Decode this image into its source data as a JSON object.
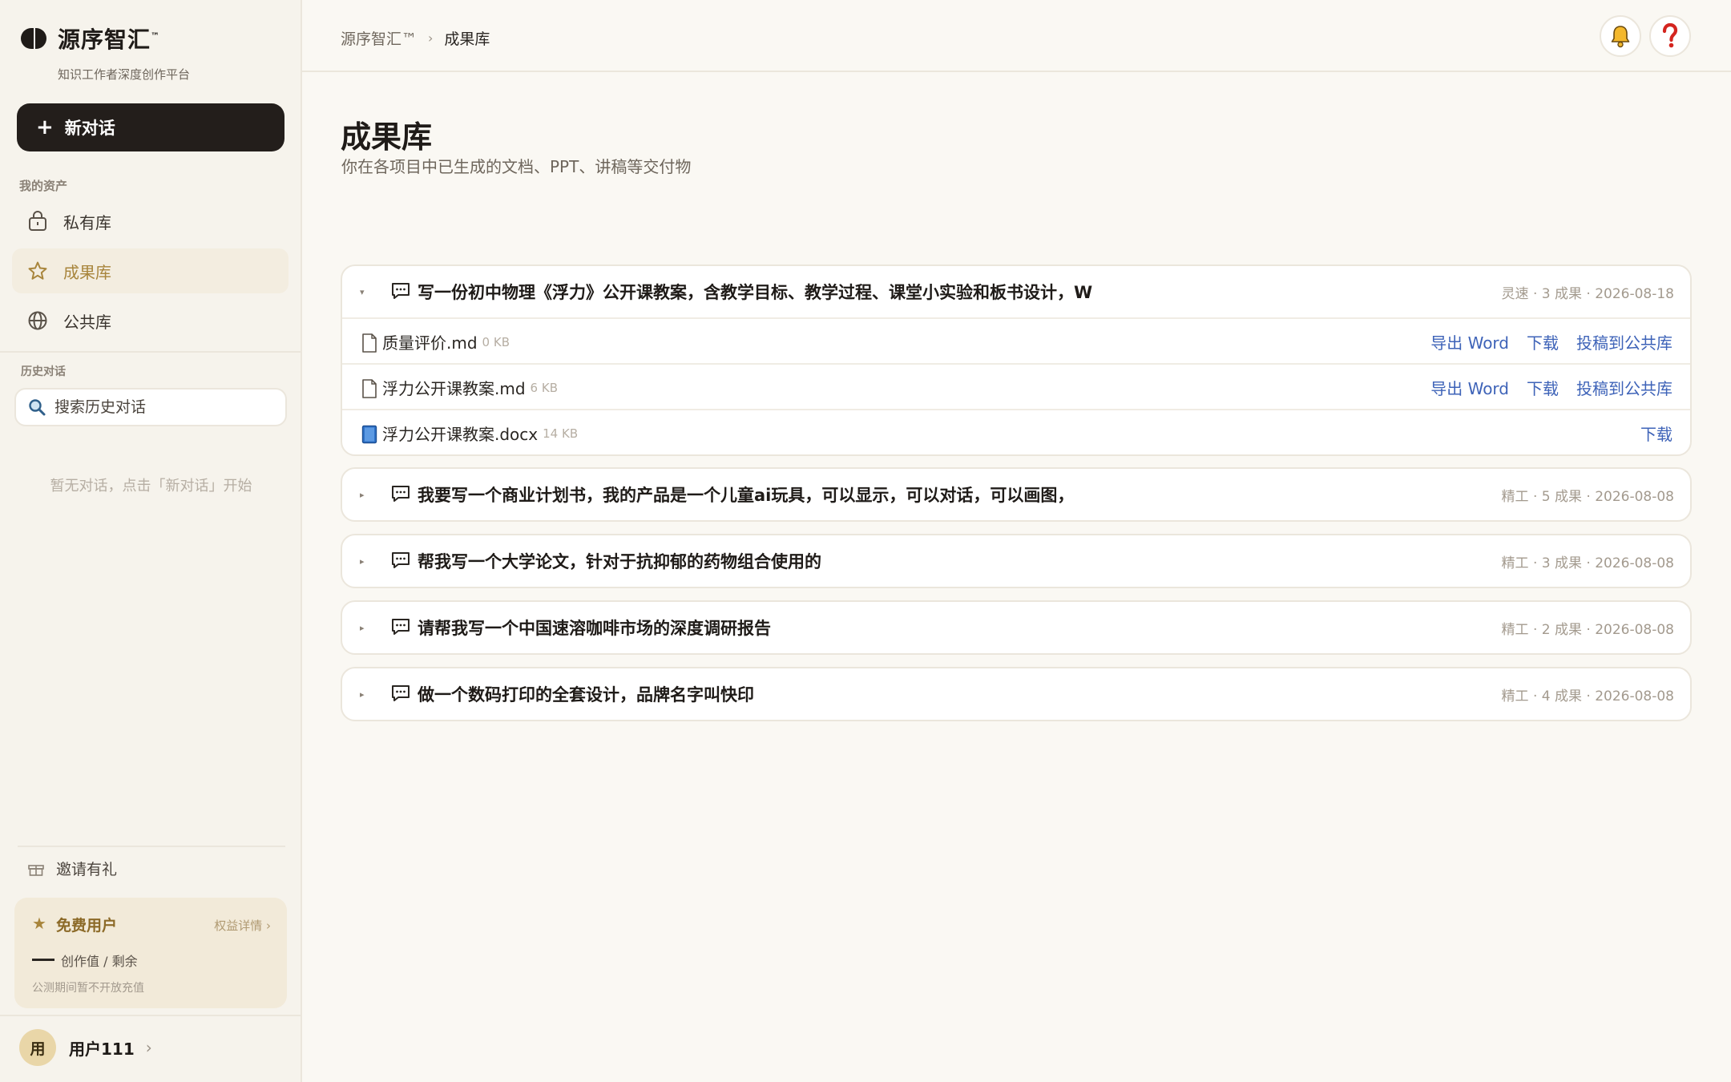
{
  "brand": {
    "name": "源序智汇",
    "tm": "™",
    "subtitle": "知识工作者深度创作平台"
  },
  "sidebar": {
    "new_chat": {
      "icon": "+",
      "label": "新对话"
    },
    "assets_title": "我的资产",
    "items": [
      {
        "label": "私有库",
        "icon": "lock-icon",
        "active": false
      },
      {
        "label": "成果库",
        "icon": "star-icon",
        "active": true
      },
      {
        "label": "公共库",
        "icon": "globe-icon",
        "active": false
      }
    ],
    "history_title": "历史对话",
    "search_placeholder": "搜索历史对话",
    "empty_hint": "暂无对话，点击「新对话」开始",
    "invite_label": "邀请有礼",
    "plan": {
      "star": "★",
      "name": "免费用户",
      "link": "权益详情 ›",
      "credit": "创作值 / 剩余",
      "note": "公测期间暂不开放充值"
    },
    "user": {
      "avatar": "用",
      "name": "用户111",
      "chevron": "›"
    }
  },
  "header": {
    "breadcrumbs": [
      "源序智汇™",
      "成果库"
    ],
    "separator": "›"
  },
  "main": {
    "title": "成果库",
    "subtitle": "你在各项目中已生成的文档、PPT、讲稿等交付物",
    "projects": [
      {
        "title": "写一份初中物理《浮力》公开课教案，含教学目标、教学过程、课堂小实验和板书设计，W",
        "meta": "灵速 · 3 成果 · 2026-08-18",
        "expanded": true,
        "toggle": "▾",
        "files": [
          {
            "name": "质量评价.md",
            "size": "0 KB",
            "type": "md",
            "actions": [
              "导出 Word",
              "下载",
              "投稿到公共库"
            ]
          },
          {
            "name": "浮力公开课教案.md",
            "size": "6 KB",
            "type": "md",
            "actions": [
              "导出 Word",
              "下载",
              "投稿到公共库"
            ]
          },
          {
            "name": "浮力公开课教案.docx",
            "size": "14 KB",
            "type": "docx",
            "actions": [
              "下载"
            ]
          }
        ]
      },
      {
        "title": "我要写一个商业计划书，我的产品是一个儿童ai玩具，可以显示，可以对话，可以画图，",
        "meta": "精工 · 5 成果 · 2026-08-08",
        "expanded": false,
        "toggle": "▸"
      },
      {
        "title": "帮我写一个大学论文，针对于抗抑郁的药物组合使用的",
        "meta": "精工 · 3 成果 · 2026-08-08",
        "expanded": false,
        "toggle": "▸"
      },
      {
        "title": "请帮我写一个中国速溶咖啡市场的深度调研报告",
        "meta": "精工 · 2 成果 · 2026-08-08",
        "expanded": false,
        "toggle": "▸"
      },
      {
        "title": "做一个数码打印的全套设计，品牌名字叫快印",
        "meta": "精工 · 4 成果 · 2026-08-08",
        "expanded": false,
        "toggle": "▸"
      }
    ]
  },
  "colors": {
    "accent_gold": "#a8853c",
    "link_blue": "#3e63b8",
    "dark": "#231e1b",
    "background": "#faf8f3"
  }
}
